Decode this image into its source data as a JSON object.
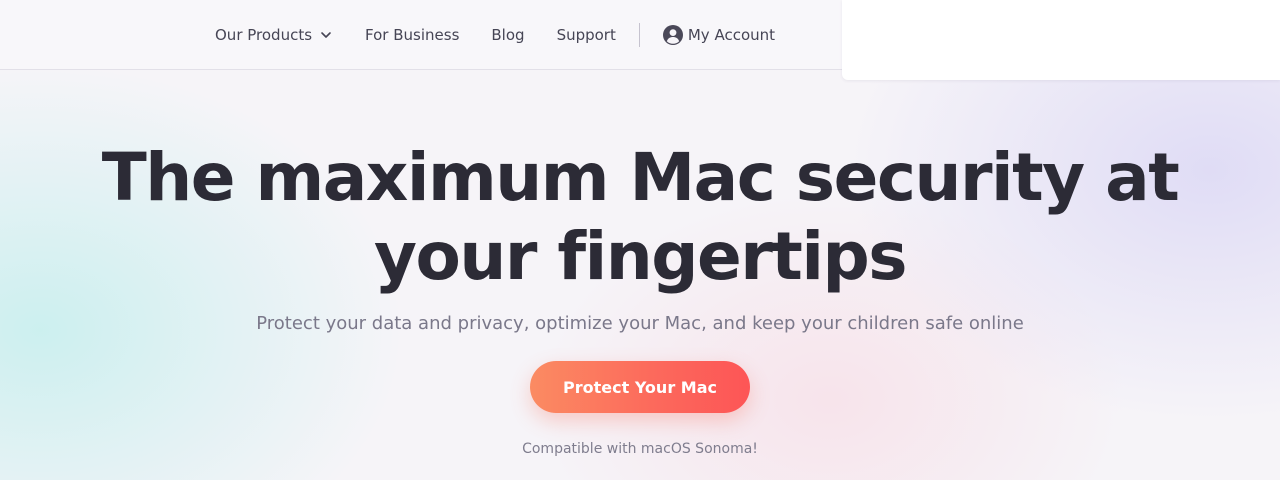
{
  "nav": {
    "products_label": "Our Products",
    "business_label": "For Business",
    "blog_label": "Blog",
    "support_label": "Support",
    "account_label": "My Account"
  },
  "hero": {
    "title": "The maximum Mac security at your fingertips",
    "subtitle": "Protect your data and privacy, optimize your Mac, and keep your children safe online",
    "cta_label": "Protect Your Mac",
    "compat_note": "Compatible with macOS Sonoma!"
  },
  "icons": {
    "products_dropdown": "chevron-down-icon",
    "account": "user-circle-icon"
  },
  "colors": {
    "title": "#2c2b36",
    "cta_gradient_start": "#fb8b62",
    "cta_gradient_end": "#fd5556",
    "subtitle": "#7a788a"
  }
}
